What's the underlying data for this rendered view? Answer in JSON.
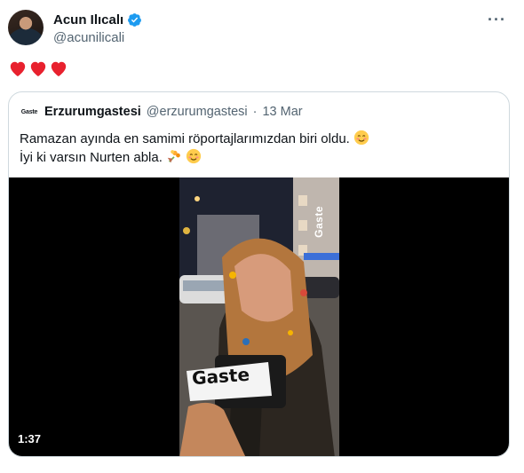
{
  "author": {
    "name": "Acun Ilıcalı",
    "handle": "@acunilicali",
    "more_label": "···"
  },
  "tweet": {
    "emojis": [
      "red-heart",
      "red-heart",
      "red-heart"
    ]
  },
  "quote": {
    "avatar_text": "Gaste",
    "name": "Erzurumgastesi",
    "handle": "@erzurumgastesi",
    "separator": "·",
    "date": "13 Mar",
    "line1": "Ramazan ayında en samimi röportajlarımızdan biri oldu.",
    "line2": "İyi ki varsın Nurten abla.",
    "video": {
      "duration": "1:37",
      "watermark": "Gaste",
      "mic_label": "Gaste"
    }
  },
  "colors": {
    "verified": "#1d9bf0",
    "heart": "#e8212e",
    "border": "#cfd9de",
    "secondary_text": "#536471"
  }
}
